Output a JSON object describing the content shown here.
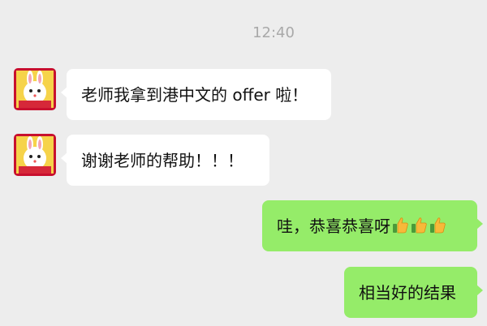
{
  "timestamp": "12:40",
  "messages": [
    {
      "side": "received",
      "text": "老师我拿到港中文的 offer 啦！"
    },
    {
      "side": "received",
      "text": "谢谢老师的帮助！！！"
    },
    {
      "side": "sent",
      "text": "哇，恭喜恭喜呀",
      "emoji": [
        "thumbs-up",
        "thumbs-up",
        "thumbs-up"
      ]
    },
    {
      "side": "sent",
      "text": "相当好的结果"
    }
  ],
  "colors": {
    "background": "#ededed",
    "received_bubble": "#ffffff",
    "sent_bubble": "#95ec69",
    "timestamp_text": "#a9a9a9"
  },
  "icons": {
    "avatar": "cartoon-rabbit-avatar",
    "emoji": "thumbs-up-icon"
  }
}
